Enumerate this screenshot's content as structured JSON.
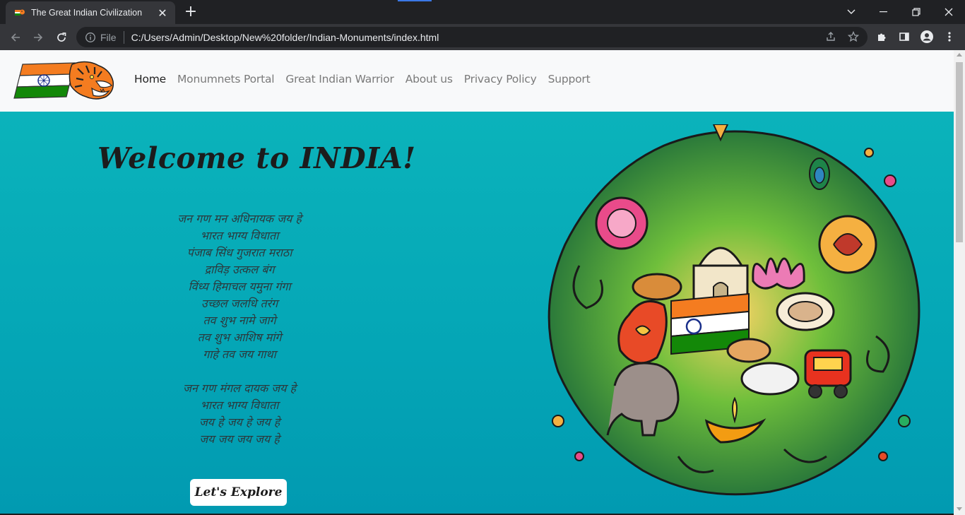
{
  "browser": {
    "tab_title": "The Great Indian Civilization",
    "tab_close": "✕",
    "new_tab": "+",
    "omnibox_scheme": "File",
    "url": "C:/Users/Admin/Desktop/New%20folder/Indian-Monuments/index.html"
  },
  "navbar": {
    "links": [
      {
        "label": "Home",
        "active": true
      },
      {
        "label": "Monumnets Portal"
      },
      {
        "label": "Great Indian Warrior"
      },
      {
        "label": "About us"
      },
      {
        "label": "Privacy Policy"
      },
      {
        "label": "Support"
      }
    ]
  },
  "hero": {
    "title": "Welcome to INDIA!",
    "anthem_verse1": [
      "जन गण मन अधिनायक जय हे",
      "भारत भाग्य विधाता",
      "पंजाब सिंध गुजरात मराठा",
      "द्राविड़ उत्कल बंग",
      "विंध्य हिमाचल यमुना गंगा",
      "उच्छल जलधि तरंग",
      "तव शुभ नामे जागे",
      "तव शुभ आशिष मांगे",
      "गाहे तव जय गाथा"
    ],
    "anthem_verse2": [
      "जन गण मंगल दायक जय हे",
      "भारत भाग्य विधाता",
      "जय हे जय हे जय हे",
      "जय जय जय जय हे"
    ],
    "button_label": "Let's Explore"
  },
  "colors": {
    "hero_teal": "#04a3b2",
    "navbar_bg": "#f8f9fa",
    "browser_dark": "#202124",
    "saffron": "#f47c20",
    "india_green": "#138808"
  }
}
